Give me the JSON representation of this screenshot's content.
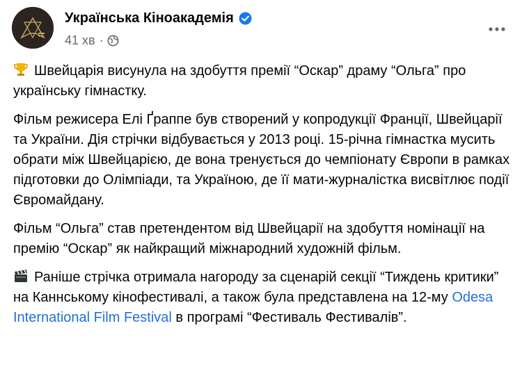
{
  "post": {
    "author": "Українська Кіноакадемія",
    "time": "41 хв",
    "dot": "·",
    "paragraphs": {
      "p1_text": "Швейцарія висунула на здобуття премії “Оскар” драму “Ольга” про українську гімнастку.",
      "p2_text": "Фільм режисера Елі Ґраппе був створений у копродукції Франції, Швейцарії та України. Дія стрічки відбувається у 2013 році. 15-річна гімнастка мусить обрати між Швейцарією, де вона тренується до чемпіонату Європи в рамках підготовки до Олімпіади, та Україною, де її мати-журналістка висвітлює події Євромайдану.",
      "p3_text": "Фільм “Ольга” став претендентом від Швейцарії на здобуття номінації на премію “Оскар” як найкращий міжнародний художній фільм.",
      "p4_before": "Раніше стрічка отримала нагороду за сценарій секції “Тиждень критики” на Каннському кінофестивалі, а також була представлена на 12-му ",
      "p4_link": "Odesa International Film Festival",
      "p4_after": " в програмі “Фестиваль Фестивалів”."
    },
    "icons": {
      "verified": "verified-badge-icon",
      "audience": "globe-icon",
      "menu": "more-options-icon",
      "trophy": "trophy-emoji",
      "clapper": "clapper-board-emoji"
    },
    "colors": {
      "link": "#216fdb",
      "meta": "#65676b",
      "verified": "#1877f2"
    }
  }
}
